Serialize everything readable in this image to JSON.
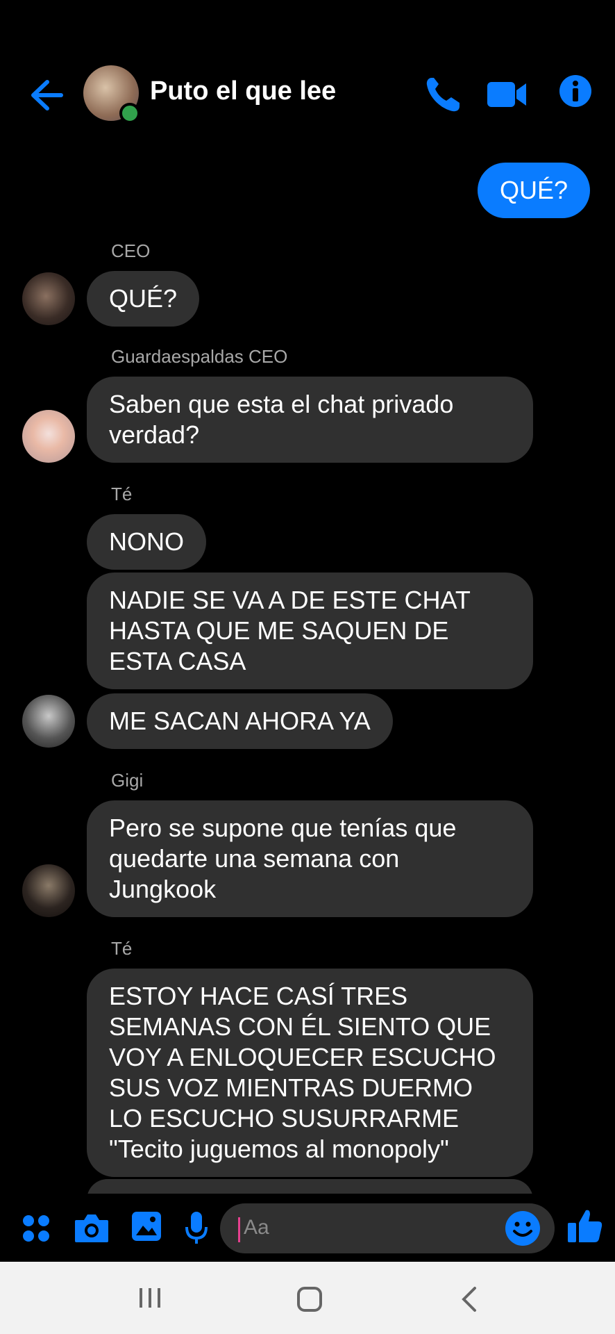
{
  "header": {
    "title": "Puto el que lee",
    "colors": {
      "accent": "#0a7cff",
      "online": "#31a24c"
    }
  },
  "messages": {
    "outgoing_1": "QUÉ?",
    "sender_ceo": "CEO",
    "ceo_msg": "QUÉ?",
    "sender_guarda": "Guardaespaldas CEO",
    "guarda_msg": "Saben que esta el chat privado verdad?",
    "sender_te_1": "Té",
    "te_msg_1": "NONO",
    "te_msg_2": "NADIE SE VA A DE ESTE CHAT HASTA QUE ME SAQUEN DE ESTA CASA",
    "te_msg_3": "ME SACAN AHORA YA",
    "sender_gigi": "Gigi",
    "gigi_msg": "Pero se supone que tenías que quedarte una semana con Jungkook",
    "sender_te_2": "Té",
    "te_msg_4": "ESTOY HACE CASÍ TRES SEMANAS CON ÉL SIENTO QUE VOY A ENLOQUECER ESCUCHO SUS VOZ MIENTRAS DUERMO LO ESCUCHO SUSURRARME \"Tecito juguemos al monopoly\""
  },
  "composer": {
    "placeholder": "Aa",
    "icons": [
      "apps-icon",
      "camera-icon",
      "gallery-icon",
      "microphone-icon",
      "emoji-icon",
      "like-icon"
    ]
  },
  "navbar": {
    "icons": [
      "recents-icon",
      "home-icon",
      "back-icon"
    ]
  }
}
